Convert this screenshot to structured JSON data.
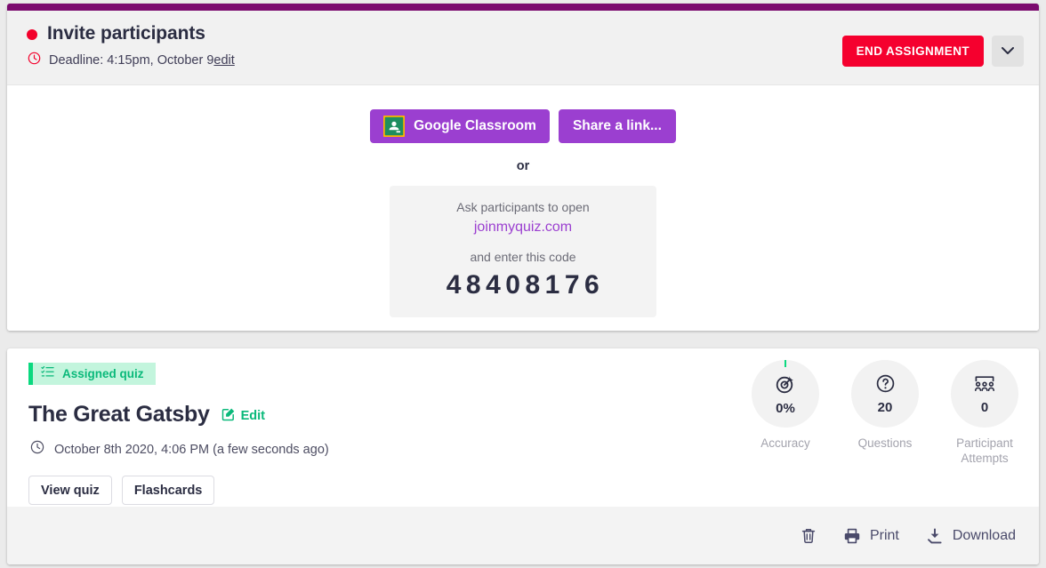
{
  "invite_card": {
    "accent_bar_color": "#7b0a6e",
    "status_dot_color": "#f3002b",
    "title": "Invite participants",
    "deadline_icon": "clock-icon",
    "deadline_text": "Deadline: 4:15pm, October 9",
    "deadline_edit_label": "edit",
    "end_button_label": "END ASSIGNMENT",
    "end_button_color": "#f5002e",
    "dropdown_icon": "chevron-down-icon",
    "share": {
      "google_classroom_label": "Google Classroom",
      "google_classroom_icon": "google-classroom-icon",
      "share_link_label": "Share a link...",
      "button_color": "#9b3fd0"
    },
    "or_label": "or",
    "join": {
      "instruction_1": "Ask participants to open",
      "url": "joinmyquiz.com",
      "url_color": "#9b3fd0",
      "instruction_2": "and enter this code",
      "code": "48408176"
    }
  },
  "quiz_card": {
    "badge_label": "Assigned quiz",
    "badge_icon": "checklist-icon",
    "badge_color": "#0ab97a",
    "title": "The Great Gatsby",
    "edit_label": "Edit",
    "edit_icon": "pencil-square-icon",
    "date_icon": "clock-icon",
    "date_text": "October 8th 2020, 4:06 PM (a few seconds ago)",
    "buttons": [
      {
        "label": "View quiz"
      },
      {
        "label": "Flashcards"
      }
    ],
    "stats": [
      {
        "icon": "target-accuracy-icon",
        "value": "0%",
        "label": "Accuracy"
      },
      {
        "icon": "question-circle-icon",
        "value": "20",
        "label": "Questions"
      },
      {
        "icon": "audience-group-icon",
        "value": "0",
        "label": "Participant Attempts"
      }
    ],
    "footer": {
      "delete_icon": "trash-icon",
      "print_icon": "printer-icon",
      "print_label": "Print",
      "download_icon": "download-icon",
      "download_label": "Download"
    }
  }
}
